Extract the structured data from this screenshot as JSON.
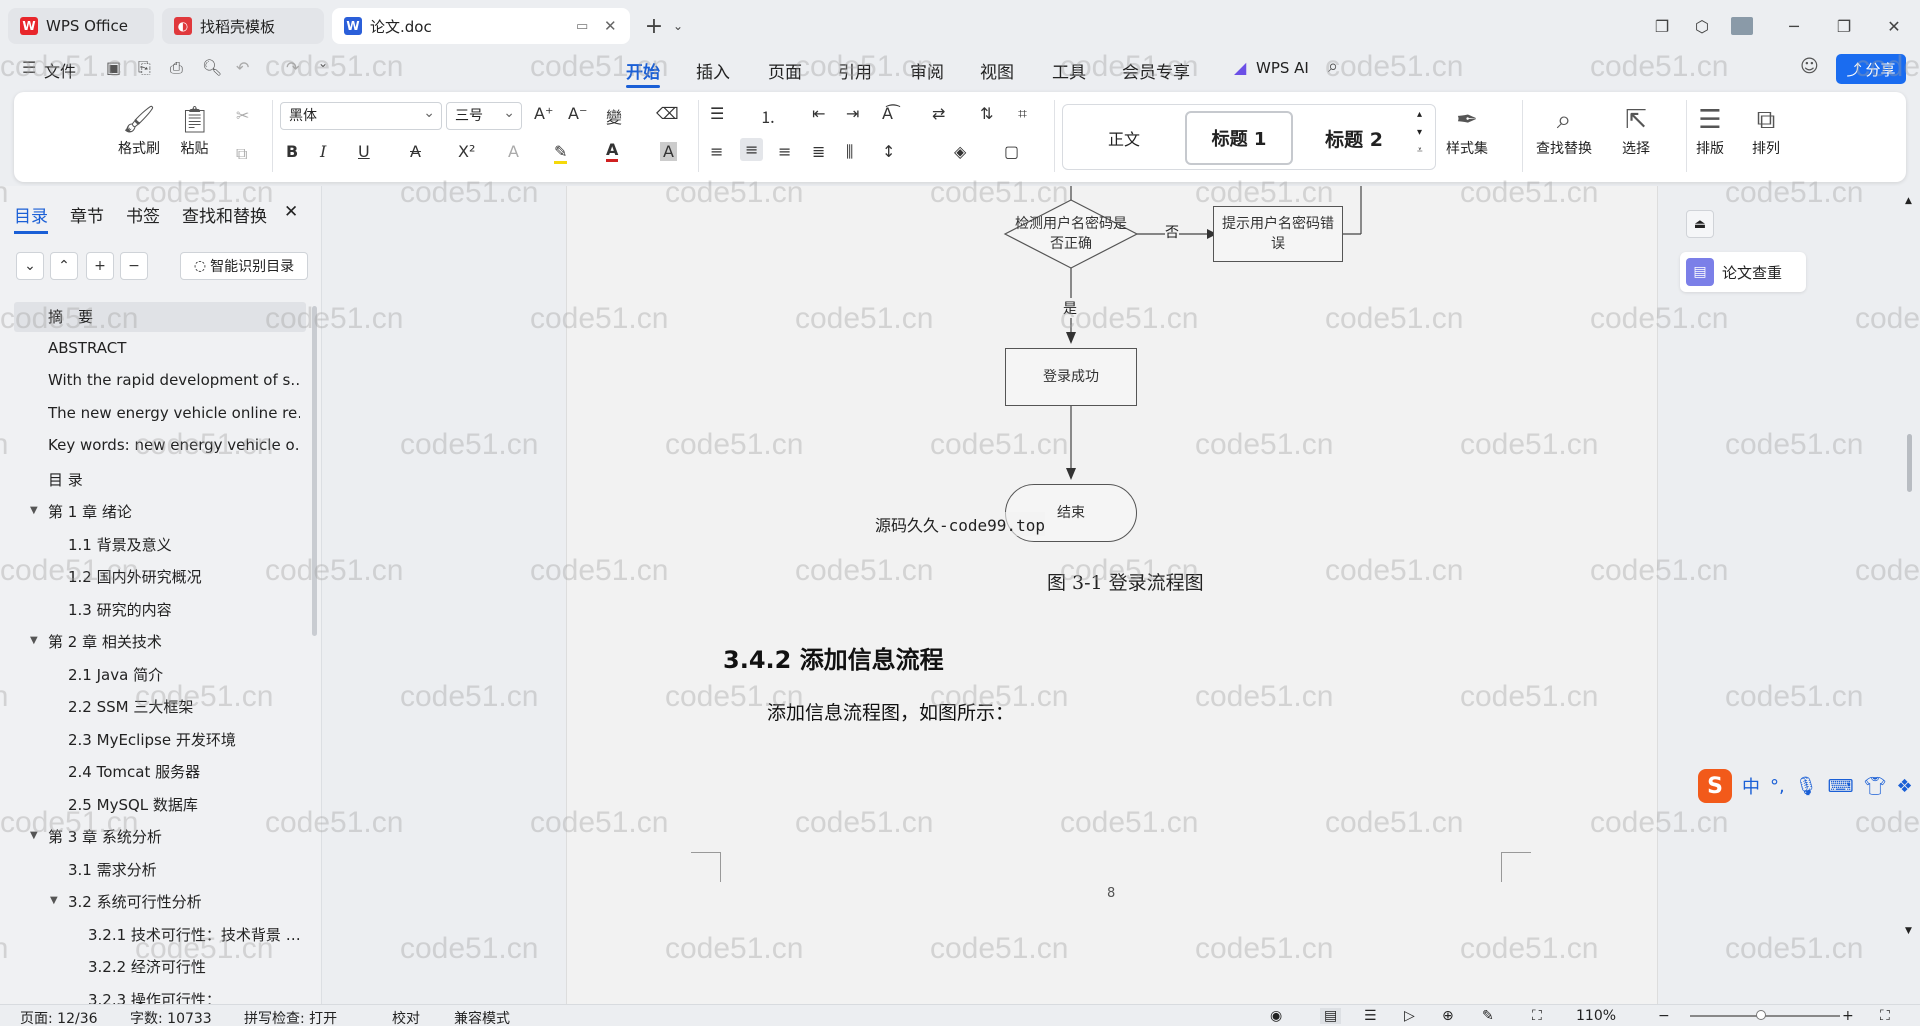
{
  "tabs": [
    {
      "label": "WPS Office"
    },
    {
      "label": "找稻壳模板"
    },
    {
      "label": "论文.doc"
    }
  ],
  "menu": {
    "file": "文件",
    "items": [
      "开始",
      "插入",
      "页面",
      "引用",
      "审阅",
      "视图",
      "工具",
      "会员专享"
    ],
    "ai": "WPS AI",
    "share": "分享"
  },
  "ribbon": {
    "format_brush": "格式刷",
    "paste": "粘贴",
    "font_name": "黑体",
    "font_size": "三号",
    "styles": [
      "正文",
      "标题 1",
      "标题 2"
    ],
    "style_set": "样式集",
    "find_replace": "查找替换",
    "select": "选择",
    "layout": "排版",
    "arrange": "排列"
  },
  "sidebar": {
    "tabs": [
      "目录",
      "章节",
      "书签",
      "查找和替换"
    ],
    "smart_toc": "智能识别目录",
    "toc": [
      {
        "label": "摘　要",
        "level": 0,
        "selected": true
      },
      {
        "label": "ABSTRACT",
        "level": 0
      },
      {
        "label": "With the rapid development of s…",
        "level": 0
      },
      {
        "label": "The new energy vehicle online re…",
        "level": 0
      },
      {
        "label": "Key words: new energy vehicle o…",
        "level": 0
      },
      {
        "label": "目 录",
        "level": 0
      },
      {
        "label": "第 1 章  绪论",
        "level": 0,
        "expand": true
      },
      {
        "label": "1.1 背景及意义",
        "level": 1
      },
      {
        "label": "1.2 国内外研究概况",
        "level": 1
      },
      {
        "label": "1.3 研究的内容",
        "level": 1
      },
      {
        "label": "第 2 章  相关技术",
        "level": 0,
        "expand": true
      },
      {
        "label": "2.1 Java 简介",
        "level": 1
      },
      {
        "label": "2.2 SSM 三大框架",
        "level": 1
      },
      {
        "label": "2.3 MyEclipse 开发环境",
        "level": 1
      },
      {
        "label": "2.4 Tomcat 服务器",
        "level": 1
      },
      {
        "label": "2.5 MySQL 数据库",
        "level": 1
      },
      {
        "label": "第 3 章  系统分析",
        "level": 0,
        "expand": true
      },
      {
        "label": "3.1 需求分析",
        "level": 1
      },
      {
        "label": "3.2 系统可行性分析",
        "level": 1,
        "expand": true
      },
      {
        "label": "3.2.1 技术可行性：技术背景 …",
        "level": 2
      },
      {
        "label": "3.2.2 经济可行性",
        "level": 2
      },
      {
        "label": "3.2.3 操作可行性：",
        "level": 2
      }
    ]
  },
  "document": {
    "flow": {
      "decision": "检测用户名密码是否正确",
      "error_box": "提示用户名密码错误",
      "no_label": "否",
      "yes_label": "是",
      "success": "登录成功",
      "end": "结束"
    },
    "source_note": "源码久久-code99.top",
    "caption": "图 3-1 登录流程图",
    "heading": "3.4.2 添加信息流程",
    "paragraph": "添加信息流程图，如图所示：",
    "page_number": "8"
  },
  "right_panel": {
    "check": "论文查重"
  },
  "watermark": "code51.cn",
  "status": {
    "page": "页面: 12/36",
    "words": "字数: 10733",
    "spell": "拼写检查: 打开",
    "proof": "校对",
    "compat": "兼容模式",
    "zoom": "110%"
  }
}
